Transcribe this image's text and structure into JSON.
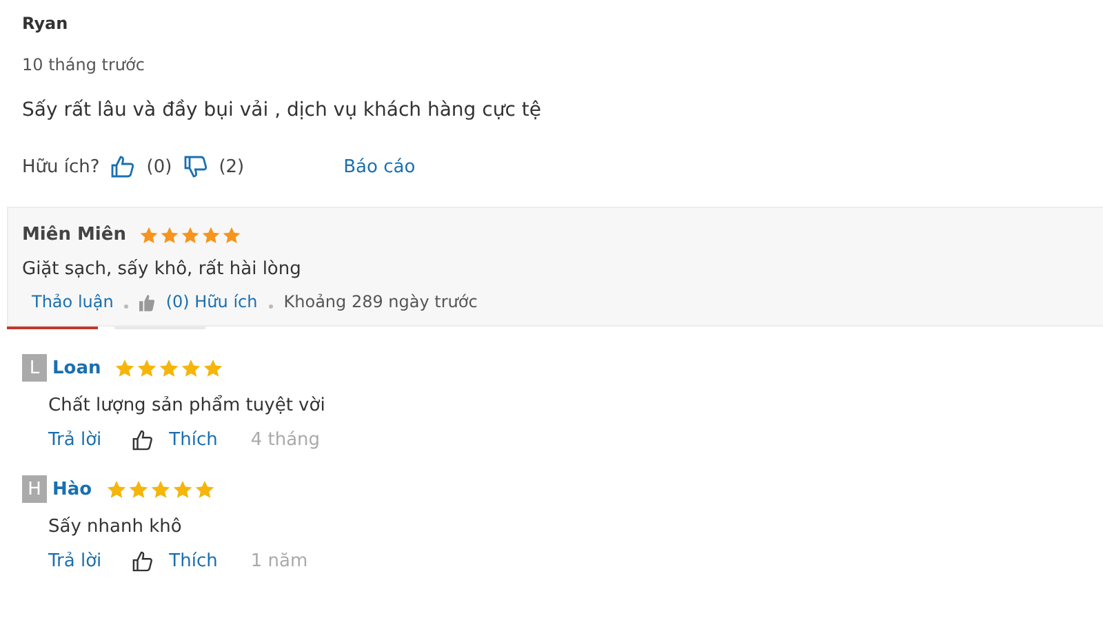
{
  "review": {
    "author": "Ryan",
    "time": "10 tháng trước",
    "text": "Sấy rất lâu và đầy bụi vải , dịch vụ khách hàng cực tệ",
    "helpful_label": "Hữu ích?",
    "likes": "(0)",
    "dislikes": "(2)",
    "report": "Báo cáo"
  },
  "rating_card": {
    "author": "Miên Miên",
    "stars": 5,
    "text": "Giặt sạch, sấy khô, rất hài lòng",
    "discuss": "Thảo luận",
    "helpful": "(0) Hữu ích",
    "time": "Khoảng 289 ngày trước"
  },
  "tabs": [
    {
      "selected": true
    },
    {
      "selected": false
    }
  ],
  "comments": [
    {
      "initial": "L",
      "author": "Loan",
      "stars": 5,
      "text": "Chất lượng sản phẩm tuyệt vời",
      "reply": "Trả lời",
      "like": "Thích",
      "time": "4 tháng"
    },
    {
      "initial": "H",
      "author": "Hào",
      "stars": 5,
      "text": "Sấy nhanh khô",
      "reply": "Trả lời",
      "like": "Thích",
      "time": "1 năm"
    }
  ]
}
